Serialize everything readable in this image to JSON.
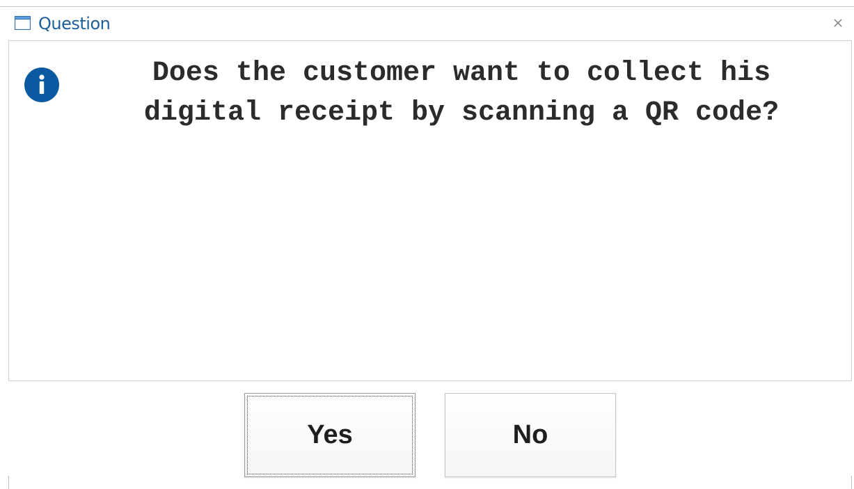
{
  "window": {
    "title": "Question",
    "icon": "window-icon",
    "close_icon": "close-icon",
    "close_glyph": "×"
  },
  "dialog": {
    "icon": "info-icon",
    "message": "Does the customer want to collect his digital receipt by scanning a QR code?"
  },
  "buttons": {
    "yes_label": "Yes",
    "no_label": "No"
  },
  "colors": {
    "title_text": "#1c5f9c",
    "info_icon": "#0b5aa1",
    "message_text": "#2b2b2b"
  }
}
